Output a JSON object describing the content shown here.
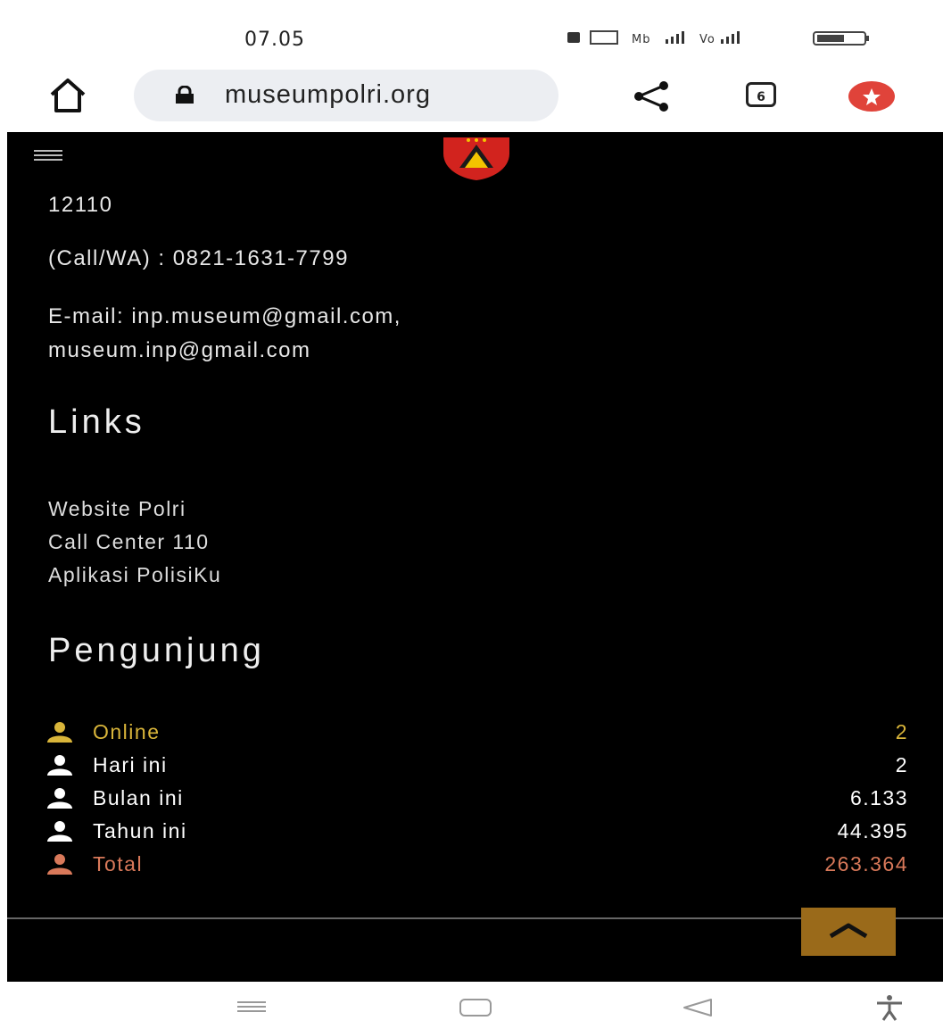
{
  "status_bar": {
    "time": "07.05",
    "icons_text": "■ ⵘ ᵐᵇ .ıl ᵛᵒᵐ .ıl ▭"
  },
  "browser": {
    "url": "museumpolri.org",
    "tab_count": "6"
  },
  "contact": {
    "postal_code": "12110",
    "phone": "(Call/WA) : 0821-1631-7799",
    "email_line1": "E-mail: inp.museum@gmail.com,",
    "email_line2": "museum.inp@gmail.com"
  },
  "links": {
    "heading": "Links",
    "items": [
      {
        "label": "Website Polri"
      },
      {
        "label": "Call Center 110"
      },
      {
        "label": "Aplikasi PolisiKu"
      }
    ]
  },
  "visitors": {
    "heading": "Pengunjung",
    "rows": [
      {
        "label": "Online",
        "value": "2",
        "color": "#d9b53a"
      },
      {
        "label": "Hari ini",
        "value": "2",
        "color": "#ffffff"
      },
      {
        "label": "Bulan ini",
        "value": "6.133",
        "color": "#ffffff"
      },
      {
        "label": "Tahun ini",
        "value": "44.395",
        "color": "#ffffff"
      },
      {
        "label": "Total",
        "value": "263.364",
        "color": "#d9795a"
      }
    ]
  },
  "icons": {
    "home": "home-icon",
    "lock": "lock-icon",
    "share": "share-icon",
    "tabs": "tabs-icon",
    "extension": "extension-icon",
    "menu": "hamburger-icon",
    "user": "user-icon",
    "back_to_top": "chevron-up-icon"
  },
  "colors": {
    "page_bg": "#000000",
    "accent_button": "#9a6a1a"
  }
}
